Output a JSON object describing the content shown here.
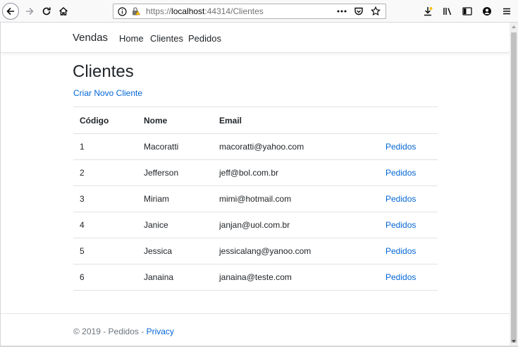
{
  "browser": {
    "url_prefix": "https://",
    "url_host": "localhost",
    "url_rest": ":44314/Clientes",
    "icons": [
      "back-icon",
      "forward-icon",
      "reload-icon",
      "home-icon",
      "info-icon",
      "lock-warning-icon",
      "page-actions-icon",
      "pocket-icon",
      "bookmark-star-icon",
      "download-icon",
      "library-icon",
      "sidebar-icon",
      "account-icon",
      "menu-icon"
    ]
  },
  "navbar": {
    "brand": "Vendas",
    "links": [
      "Home",
      "Clientes",
      "Pedidos"
    ]
  },
  "main": {
    "title": "Clientes",
    "create_link": "Criar Novo Cliente",
    "table": {
      "headers": [
        "Código",
        "Nome",
        "Email",
        ""
      ],
      "rows": [
        {
          "codigo": "1",
          "nome": "Macoratti",
          "email": "macoratti@yahoo.com",
          "action": "Pedidos"
        },
        {
          "codigo": "2",
          "nome": "Jefferson",
          "email": "jeff@bol.com.br",
          "action": "Pedidos"
        },
        {
          "codigo": "3",
          "nome": "Miriam",
          "email": "mimi@hotmail.com",
          "action": "Pedidos"
        },
        {
          "codigo": "4",
          "nome": "Janice",
          "email": "janjan@uol.com.br",
          "action": "Pedidos"
        },
        {
          "codigo": "5",
          "nome": "Jessica",
          "email": "jessicalang@yanoo.com",
          "action": "Pedidos"
        },
        {
          "codigo": "6",
          "nome": "Janaina",
          "email": "janaina@teste.com",
          "action": "Pedidos"
        }
      ]
    }
  },
  "footer": {
    "text": "© 2019 - Pedidos - ",
    "privacy": "Privacy"
  },
  "colors": {
    "link": "#0366d6",
    "text": "#212529",
    "muted": "#6c757d"
  }
}
